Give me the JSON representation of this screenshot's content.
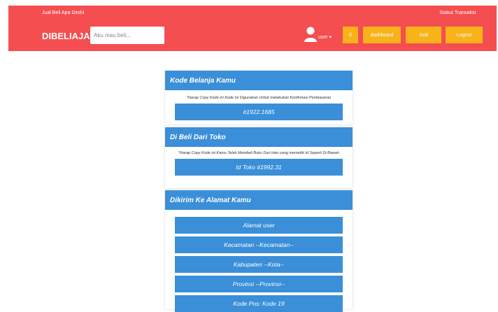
{
  "header": {
    "tagline": "Jual Beli Apa Deshi",
    "status_link": "Status Transaksi",
    "brand": "DIBELIAJA",
    "search_placeholder": "Aku mau beli...",
    "user_label": "user ▾",
    "cart_count": "0",
    "dashboard_label": "dashboard",
    "jual_label": "Jual",
    "logout_label": "Logout"
  },
  "kode_card": {
    "title": "Kode Belanja Kamu",
    "note": "*Harap Copy Kode ini Kode ini Digunakan Untuk melakukan Konfirmasi Pembayaran",
    "code": "#1922.1685"
  },
  "toko_card": {
    "title": "Di Beli Dari Toko",
    "note": "*Harap Copy Kode ini Kamu Telah Membeli Buku Dari toko yang memeliki id Seperti Di Bawah",
    "code": "Id Toko #1992.31"
  },
  "alamat_card": {
    "title": "Dikirim Ke Alamat Kamu",
    "fields": [
      "Alamat user",
      "Kecamatan --Kecamatan--",
      "Kabupaten --Kota--",
      "Provinsi --Provinsi--",
      "Kode Pos: Kode 19"
    ]
  },
  "colors": {
    "header_bg": "#f44e51",
    "accent_button": "#f9b21a",
    "card_blue": "#3a8fd8"
  }
}
